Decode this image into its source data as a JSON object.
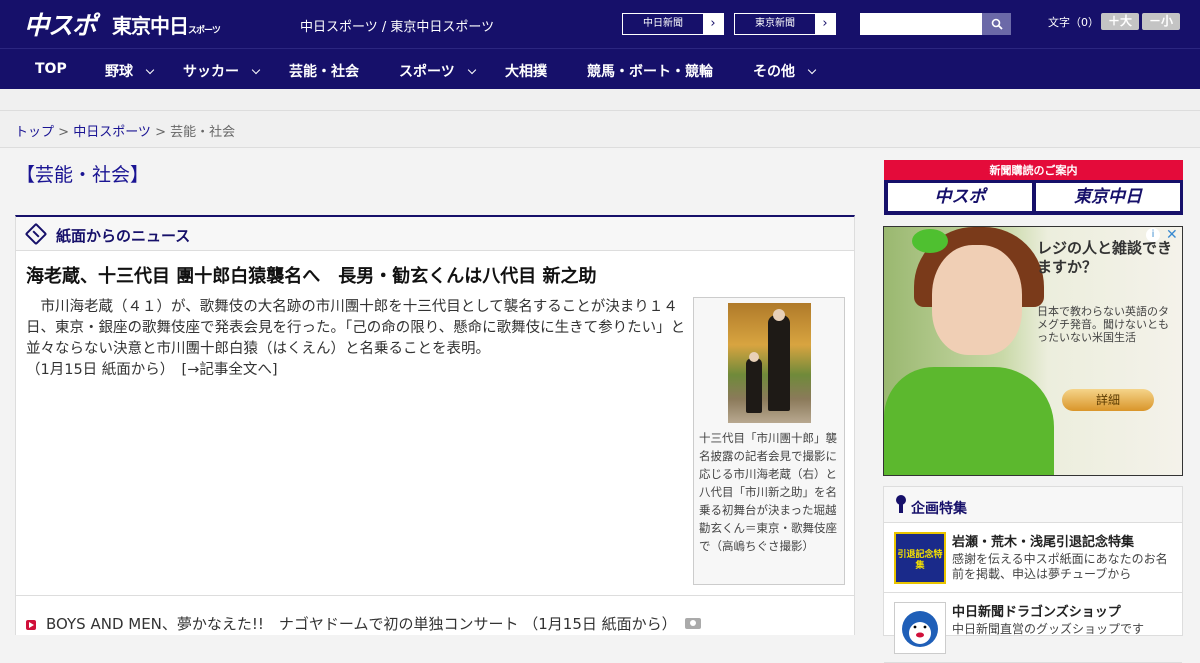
{
  "header": {
    "logo_primary": "中スポ",
    "logo_secondary": "東京中日",
    "logo_secondary_small": "スポーツ",
    "site_title": "中日スポーツ / 東京中日スポーツ",
    "paper_links": [
      {
        "label": "中日新聞"
      },
      {
        "label": "東京新聞"
      }
    ],
    "search_placeholder": "",
    "font_size_label": "文字（0）",
    "font_larger": "＋大",
    "font_smaller": "－小"
  },
  "nav": {
    "items": [
      {
        "label": "TOP"
      },
      {
        "label": "野球"
      },
      {
        "label": "サッカー"
      },
      {
        "label": "芸能・社会"
      },
      {
        "label": "スポーツ"
      },
      {
        "label": "大相撲"
      },
      {
        "label": "競馬・ボート・競輪"
      },
      {
        "label": "その他"
      }
    ]
  },
  "breadcrumb": {
    "home": "トップ",
    "sep": " > ",
    "level1": "中日スポーツ",
    "current": "芸能・社会"
  },
  "section_title": "【芸能・社会】",
  "newsbox": {
    "title": "紙面からのニュース",
    "headline": "海老蔵、十三代目 團十郎白猿襲名へ　長男・勧玄くんは八代目 新之助",
    "body": "市川海老蔵（４１）が、歌舞伎の大名跡の市川團十郎を十三代目として襲名することが決まり１４日、東京・銀座の歌舞伎座で発表会見を行った。「己の命の限り、懸命に歌舞伎に生きて参りたい」と並々ならない決意と市川團十郎白猿（はくえん）と名乗ることを表明。",
    "date_note": "（1月15日 紙面から）",
    "more_link": "[→記事全文へ]",
    "photo_caption": "十三代目「市川團十郎」襲名披露の記者会見で撮影に応じる市川海老蔵（右）と八代目「市川新之助」を名乗る初舞台が決まった堀越勸玄くん＝東京・歌舞伎座で（高嶋ちぐさ撮影）",
    "list_item": "BOYS AND MEN、夢かなえた!!　ナゴヤドームで初の単独コンサート （1月15日 紙面から）"
  },
  "sidebar": {
    "subscribe_label": "新聞購読のご案内",
    "subscribe_logo1": "中スポ",
    "subscribe_logo2": "東京中日",
    "ad": {
      "headline": "レジの人と雑談できますか？",
      "text": "日本で教わらない英語のタメグチ発音。聞けないともったいない米国生活",
      "button": "詳細",
      "info_icon": "i",
      "close_icon": "✕"
    },
    "features_title": "企画特集",
    "features": [
      {
        "title": "岩瀬・荒木・浅尾引退記念特集",
        "desc": "感謝を伝える中スポ紙面にあなたのお名前を掲載、申込は夢チューブから",
        "thumb_text": "引退記念特集"
      },
      {
        "title": "中日新聞ドラゴンズショップ",
        "desc": "中日新聞直営のグッズショップです",
        "thumb_text": ""
      }
    ]
  }
}
